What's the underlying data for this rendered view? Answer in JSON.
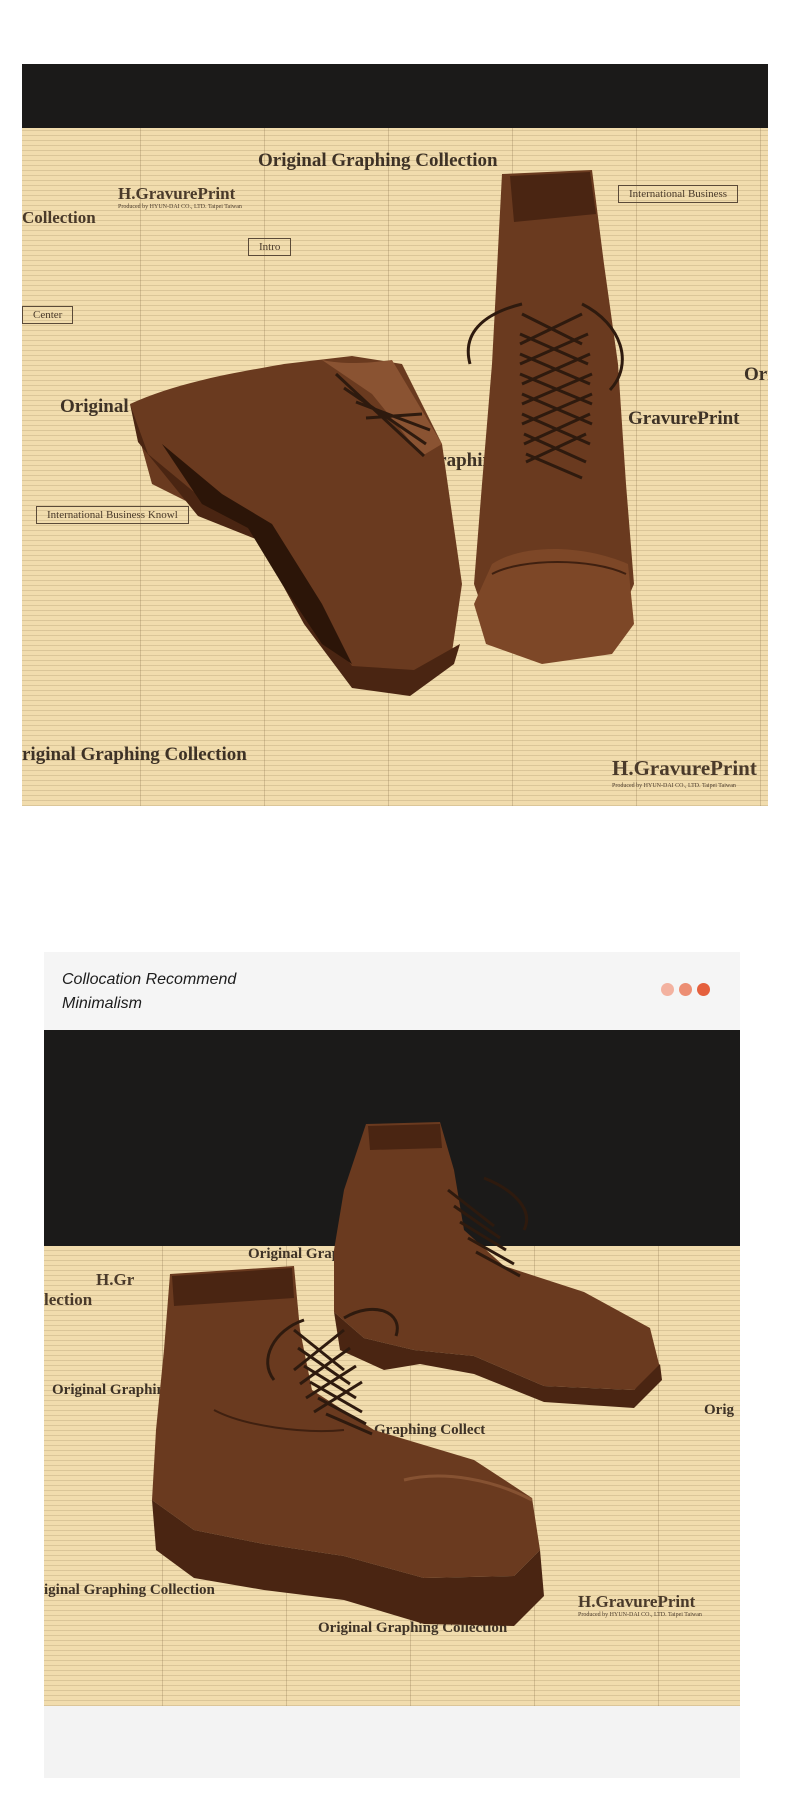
{
  "hero": {
    "newspaper": {
      "collection_title": "Original Graphing Collection",
      "collection_title_short": "Original Graphing Collection",
      "brand": "H.GravurePrint",
      "brand_sub": "Produced by HYUN-DAI CO., LTD. Taipei Taiwan",
      "business_box": "International Business",
      "business_box_left": "International Business Knowl",
      "center_box": "Center",
      "intro_box": "Intro",
      "original_left": "Original",
      "collection_left": "Collection",
      "orig_right": "Ori",
      "bottom_left": "riginal Graphing Collection",
      "bottom_right_brand": "H.GravurePrint",
      "bottom_right_sub": "Produced by HYUN-DAI CO., LTD. Taipei Taiwan",
      "mid_graphing": "inal Graphing",
      "mid_gravure": "GravurePrint"
    }
  },
  "recommend": {
    "line1": "Collocation Recommend",
    "line2": "Minimalism",
    "dot_colors": [
      "#f3b2a0",
      "#ec8e73",
      "#e5603d"
    ],
    "newspaper": {
      "top_center": "Original Graphing Collection",
      "top_left": "H.Gr",
      "collection_left": "lection",
      "mid_left": "Original Graphin",
      "mid_center": "Graphing Collect",
      "bottom_left": "iginal Graphing Collection",
      "bottom_center": "Original Graphing Collection",
      "brand": "H.GravurePrint",
      "brand_sub": "Produced by HYUN-DAI CO., LTD. Taipei Taiwan",
      "right_edge": "Orig"
    }
  },
  "colors": {
    "boot_main": "#6a3a1f",
    "boot_shadow": "#3f2010",
    "boot_highlight": "#9a6240",
    "paper": "#f1dcad",
    "dark": "#1b1a19"
  }
}
